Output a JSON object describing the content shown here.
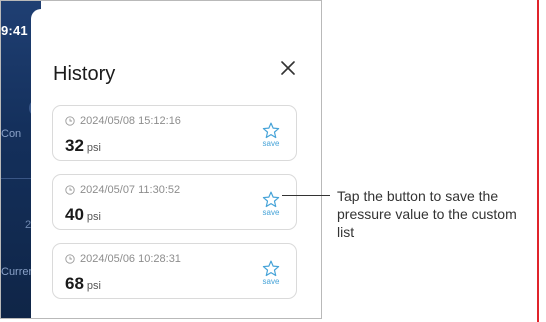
{
  "status_bar": {
    "time": "9:41"
  },
  "background": {
    "label_1": "Con",
    "label_2": "Curren",
    "digit": "2"
  },
  "history": {
    "title": "History",
    "entries": [
      {
        "timestamp": "2024/05/08 15:12:16",
        "value": "32",
        "unit": "psi",
        "save_label": "save"
      },
      {
        "timestamp": "2024/05/07 11:30:52",
        "value": "40",
        "unit": "psi",
        "save_label": "save"
      },
      {
        "timestamp": "2024/05/06 10:28:31",
        "value": "68",
        "unit": "psi",
        "save_label": "save"
      }
    ]
  },
  "annotation": {
    "text": "Tap the button to save the pressure value to the custom list"
  },
  "colors": {
    "accent": "#46a3d8",
    "annotation_rule": "#e0242b",
    "background_app": "#1f3f73"
  },
  "icons": {
    "close": "close-icon",
    "clock": "clock-icon",
    "save": "star-icon"
  }
}
